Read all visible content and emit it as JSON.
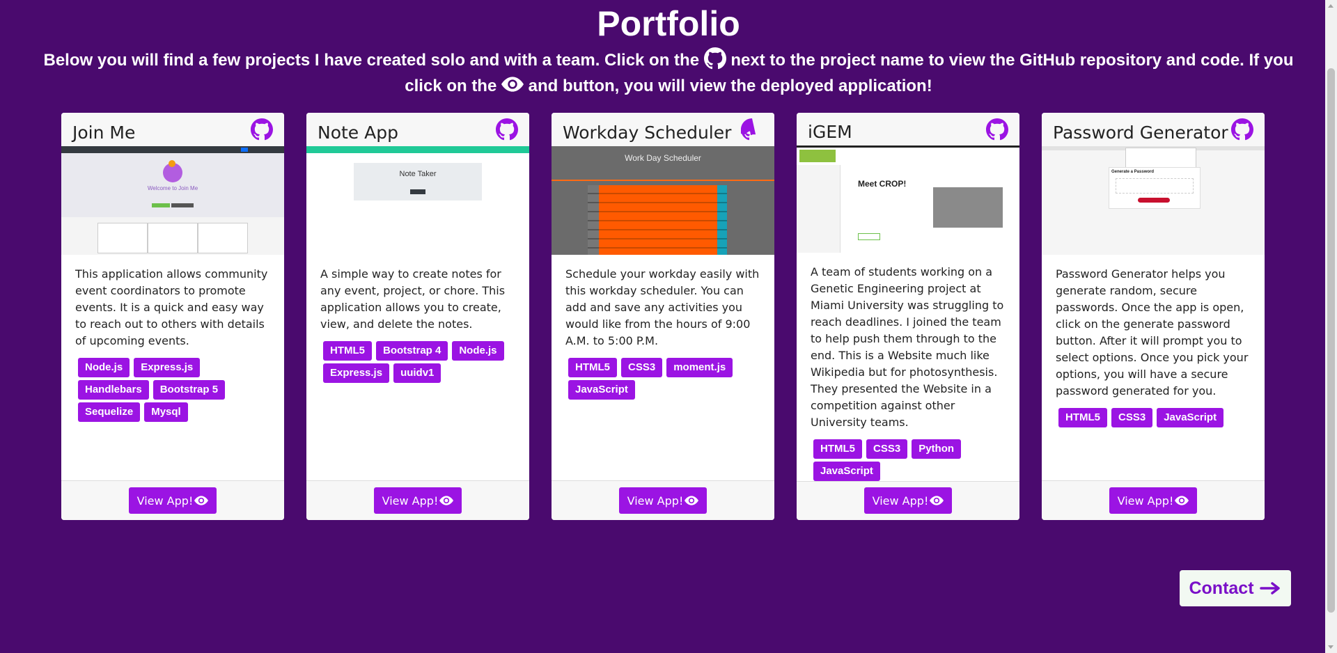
{
  "header": {
    "title": "Portfolio",
    "intro_part1": "Below you will find a few projects I have created solo and with a team. Click on the",
    "intro_part2": "next to the project name to view the GitHub repository and code. If you click on the",
    "intro_part3": "and button, you will view the deployed application!"
  },
  "projects": [
    {
      "name": "Join Me",
      "description": "This application allows community event coordinators to promote events. It is a quick and easy way to reach out to others with details of upcoming events.",
      "tags": [
        "Node.js",
        "Express.js",
        "Handlebars",
        "Bootstrap 5",
        "Sequelize",
        "Mysql"
      ],
      "button": "View App!",
      "screenshot_text": "Welcome to Join Me"
    },
    {
      "name": "Note App",
      "description": "A simple way to create notes for any event, project, or chore. This application allows you to create, view, and delete the notes.",
      "tags": [
        "HTML5",
        "Bootstrap 4",
        "Node.js",
        "Express.js",
        "uuidv1"
      ],
      "button": "View App!",
      "screenshot_text": "Note Taker"
    },
    {
      "name": "Workday Scheduler",
      "description": "Schedule your workday easily with this workday scheduler. You can add and save any activities you would like from the hours of 9:00 A.M. to 5:00 P.M.",
      "tags": [
        "HTML5",
        "CSS3",
        "moment.js",
        "JavaScript"
      ],
      "button": "View App!",
      "screenshot_text": "Work Day Scheduler"
    },
    {
      "name": "iGEM",
      "description": "A team of students working on a Genetic Engineering project at Miami University was struggling to reach deadlines. I joined the team to help push them through to the end. This is a Website much like Wikipedia but for photosynthesis. They presented the Website in a competition against other University teams.",
      "tags": [
        "HTML5",
        "CSS3",
        "Python",
        "JavaScript"
      ],
      "button": "View App!",
      "screenshot_text": "Meet CROP!"
    },
    {
      "name": "Password Generator",
      "description": "Password Generator helps you generate random, secure passwords. Once the app is open, click on the generate password button. After it will prompt you to select options. Once you pick your options, you will have a secure password generated for you.",
      "tags": [
        "HTML5",
        "CSS3",
        "JavaScript"
      ],
      "button": "View App!",
      "screenshot_text": "Generate a Password"
    }
  ],
  "contact": {
    "label": "Contact"
  },
  "colors": {
    "background": "#4a0a6e",
    "accent": "#9b14e3",
    "contact_text": "#7a10c8"
  }
}
